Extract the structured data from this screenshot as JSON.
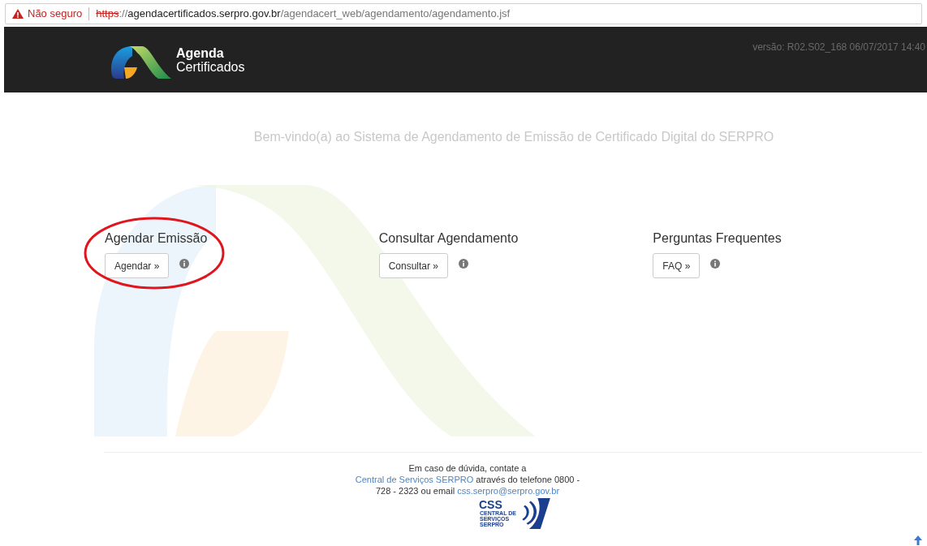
{
  "address_bar": {
    "security_warning": "Não seguro",
    "url_scheme": "https",
    "url_rest": "://",
    "url_host": "agendacertificados.serpro.gov.br",
    "url_path": "/agendacert_web/agendamento/agendamento.jsf"
  },
  "header": {
    "logo_line_1": "Agenda",
    "logo_line_2": "Certificados",
    "version": "versão: R02.S02_168 06/07/2017 14:40"
  },
  "welcome": "Bem-vindo(a) ao Sistema de Agendamento de Emissão de Certificado Digital do SERPRO",
  "sections": [
    {
      "title": "Agendar Emissão",
      "button": "Agendar »",
      "circled": true
    },
    {
      "title": "Consultar Agendamento",
      "button": "Consultar »",
      "circled": false
    },
    {
      "title": "Perguntas Frequentes",
      "button": "FAQ »",
      "circled": false
    }
  ],
  "footer": {
    "parts": [
      {
        "kind": "text",
        "text": "Em caso de dúvida, contate a "
      },
      {
        "kind": "link",
        "text": "Central de Serviços SERPRO"
      },
      {
        "kind": "text",
        "text": " através do telefone 0800 - 728 - 2323 ou email "
      },
      {
        "kind": "link",
        "text": "css.serpro@serpro.gov.br"
      }
    ],
    "logo_text": "CSS",
    "logo_lines": [
      "CENTRAL DE",
      "SERVIÇOS",
      "SERPRO"
    ]
  }
}
